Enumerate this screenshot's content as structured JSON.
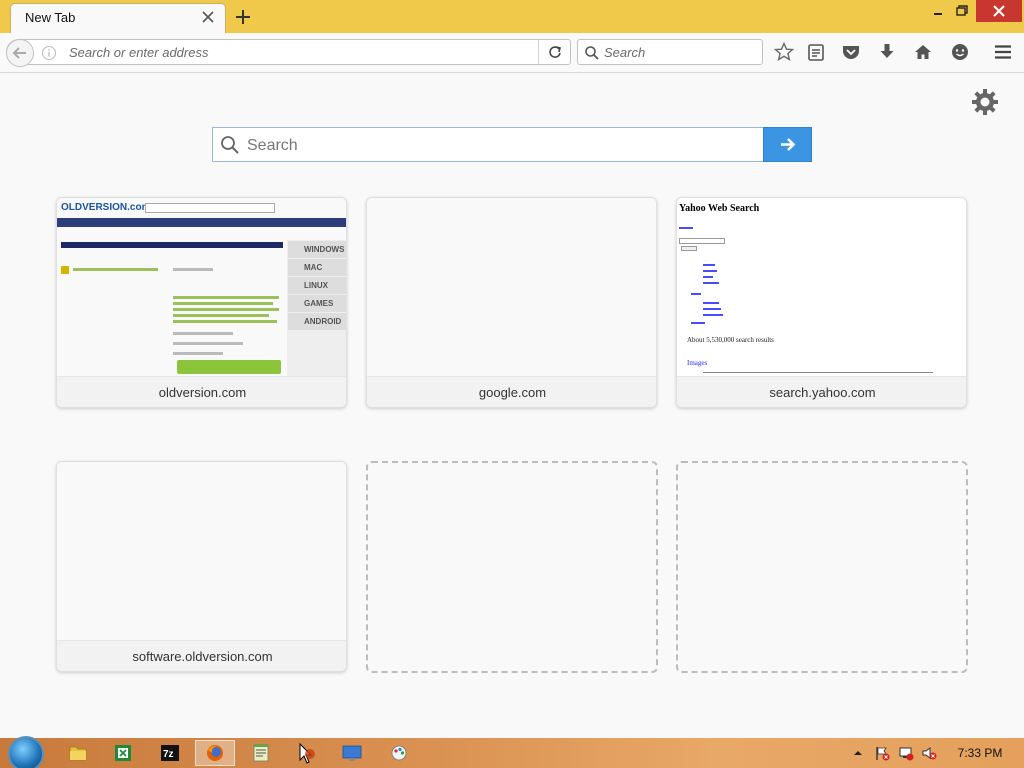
{
  "window": {
    "tab_title": "New Tab"
  },
  "navbar": {
    "url_placeholder": "Search or enter address",
    "search_placeholder": "Search"
  },
  "newtab": {
    "search_placeholder": "Search",
    "tiles": [
      {
        "label": "oldversion.com"
      },
      {
        "label": "google.com"
      },
      {
        "label": "search.yahoo.com"
      },
      {
        "label": "software.oldversion.com"
      }
    ],
    "thumb_oldversion": {
      "logo": "OLDVERSION.com",
      "side_items": [
        "WINDOWS",
        "MAC",
        "LINUX",
        "GAMES",
        "ANDROID"
      ]
    },
    "thumb_yahoo": {
      "title": "Yahoo Web Search",
      "results_text": "About 5,530,000 search results",
      "images_label": "Images"
    }
  },
  "taskbar": {
    "clock": "7:33 PM"
  },
  "colors": {
    "titlebar": "#f0c84a",
    "accent_blue": "#3b95e3",
    "close_red": "#c7372f"
  }
}
